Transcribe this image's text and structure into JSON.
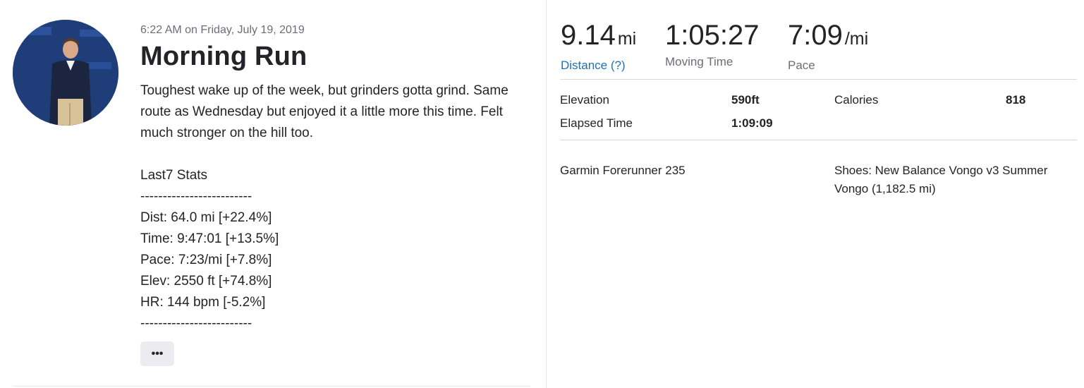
{
  "activity": {
    "timestamp": "6:22 AM on Friday, July 19, 2019",
    "title": "Morning Run",
    "description": "Toughest wake up of the week, but grinders gotta grind. Same route as Wednesday but enjoyed it a little more this time. Felt much stronger on the hill too.\n\nLast7 Stats\n-------------------------\nDist: 64.0 mi [+22.4%]\nTime: 9:47:01 [+13.5%]\nPace: 7:23/mi [+7.8%]\nElev: 2550 ft [+74.8%]\nHR: 144 bpm [-5.2%]\n-------------------------",
    "more_label": "•••"
  },
  "stats": {
    "distance_value": "9.14",
    "distance_unit": "mi",
    "distance_label": "Distance (?)",
    "moving_time_value": "1:05:27",
    "moving_time_label": "Moving Time",
    "pace_value": "7:09",
    "pace_unit": "/mi",
    "pace_label": "Pace"
  },
  "secondary": {
    "elevation_label": "Elevation",
    "elevation_value": "590ft",
    "calories_label": "Calories",
    "calories_value": "818",
    "elapsed_label": "Elapsed Time",
    "elapsed_value": "1:09:09"
  },
  "gear": {
    "device": "Garmin Forerunner 235",
    "shoes": "Shoes: New Balance Vongo v3 Summer Vongo (1,182.5 mi)"
  },
  "colors": {
    "link": "#1a73b5",
    "text": "#242428",
    "muted": "#6d6d78"
  }
}
